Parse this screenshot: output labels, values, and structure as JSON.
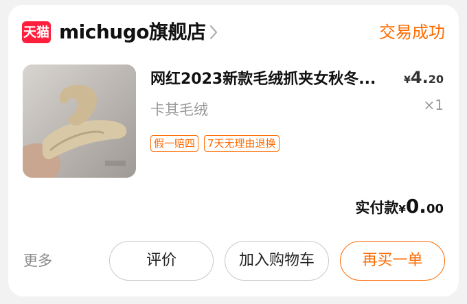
{
  "shop": {
    "badge": "天猫",
    "name": "michugo旗舰店",
    "status": "交易成功"
  },
  "product": {
    "title": "网红2023新款毛绒抓夹女秋冬...",
    "variant": "卡其毛绒",
    "price": {
      "currency": "¥",
      "integer": "4.",
      "decimal": "20"
    },
    "quantity": "×1",
    "tags": [
      "假一赔四",
      "7天无理由退换"
    ]
  },
  "payment": {
    "label": "实付款",
    "currency": "¥",
    "integer": "0.",
    "decimal": "00"
  },
  "actions": {
    "more": "更多",
    "review": "评价",
    "add_to_cart": "加入购物车",
    "rebuy": "再买一单"
  },
  "colors": {
    "accent": "#ff6a00",
    "tmall_red": "#ff1f3d"
  }
}
